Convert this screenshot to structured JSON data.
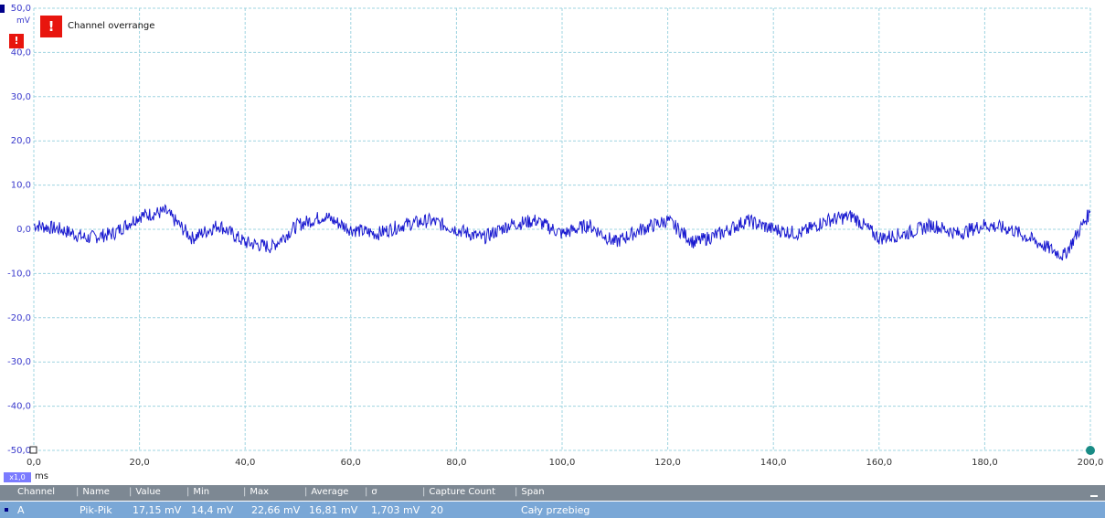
{
  "scope": {
    "y_axis": {
      "unit": "mV",
      "ticks": [
        "50,0",
        "40,0",
        "30,0",
        "20,0",
        "10,0",
        "0,0",
        "-10,0",
        "-20,0",
        "-30,0",
        "-40,0",
        "-50,0"
      ],
      "range": [
        -50,
        50
      ],
      "color": "#3a3acc"
    },
    "x_axis": {
      "unit": "ms",
      "zoom_label": "x1,0",
      "ticks": [
        "0,0",
        "20,0",
        "40,0",
        "60,0",
        "80,0",
        "100,0",
        "120,0",
        "140,0",
        "160,0",
        "180,0",
        "200,0"
      ],
      "range": [
        0,
        200
      ]
    },
    "grid": true,
    "grid_color": "#9fd4e0",
    "trace_color": "#1a1ad0",
    "overrange": {
      "message": "Channel overrange",
      "icon": "warning-icon",
      "color": "#e8150e"
    }
  },
  "chart_data": {
    "type": "line",
    "xlabel": "ms",
    "ylabel": "mV",
    "xlim": [
      0,
      200
    ],
    "ylim": [
      -50,
      50
    ],
    "grid": true,
    "x": [
      0,
      5,
      10,
      15,
      20,
      25,
      30,
      35,
      40,
      45,
      50,
      55,
      60,
      65,
      70,
      75,
      80,
      85,
      90,
      95,
      100,
      105,
      110,
      115,
      120,
      125,
      130,
      135,
      140,
      145,
      150,
      155,
      160,
      165,
      170,
      175,
      180,
      185,
      190,
      195,
      200
    ],
    "series": [
      {
        "values": [
          1,
          0,
          -2,
          -1,
          3,
          4,
          -2,
          1,
          -3,
          -4,
          1,
          3,
          0,
          -1,
          1,
          2,
          0,
          -2,
          1,
          2,
          -1,
          1,
          -3,
          0,
          2,
          -3,
          -1,
          2,
          0,
          -1,
          2,
          3,
          -2,
          -1,
          1,
          -1,
          1,
          0,
          -3,
          -6,
          4
        ]
      }
    ]
  },
  "measurements": {
    "headers": [
      "Channel",
      "Name",
      "Value",
      "Min",
      "Max",
      "Average",
      "σ",
      "Capture Count",
      "Span"
    ],
    "rows": [
      {
        "channel": "A",
        "name": "Pik-Pik",
        "value": "17,15 mV",
        "min": "14,4 mV",
        "max": "22,66 mV",
        "average": "16,81 mV",
        "sigma": "1,703 mV",
        "capture_count": "20",
        "span": "Cały przebieg"
      }
    ],
    "header_color": "#7d8893",
    "row_color": "#7aa7d6"
  }
}
